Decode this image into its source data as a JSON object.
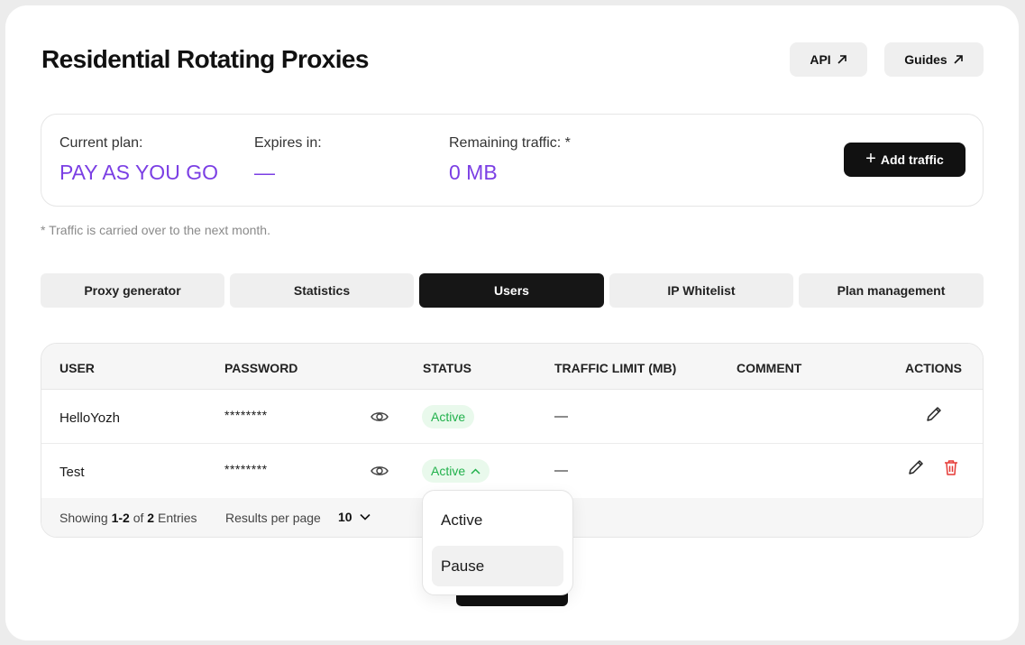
{
  "header": {
    "title": "Residential Rotating Proxies",
    "api_label": "API",
    "guides_label": "Guides"
  },
  "plan": {
    "current_plan_label": "Current plan:",
    "current_plan_value": "PAY AS YOU GO",
    "expires_label": "Expires in:",
    "expires_value": "—",
    "traffic_label": "Remaining traffic: *",
    "traffic_value": "0 MB",
    "add_traffic_label": "Add traffic"
  },
  "note": "* Traffic is carried over to the next month.",
  "tabs": [
    {
      "label": "Proxy generator",
      "active": false
    },
    {
      "label": "Statistics",
      "active": false
    },
    {
      "label": "Users",
      "active": true
    },
    {
      "label": "IP Whitelist",
      "active": false
    },
    {
      "label": "Plan management",
      "active": false
    }
  ],
  "table": {
    "columns": [
      "USER",
      "PASSWORD",
      "STATUS",
      "TRAFFIC LIMIT (MB)",
      "COMMENT",
      "ACTIONS"
    ],
    "rows": [
      {
        "user": "HelloYozh",
        "password": "********",
        "status": "Active",
        "traffic_limit": "—",
        "comment": ""
      },
      {
        "user": "Test",
        "password": "********",
        "status": "Active",
        "traffic_limit": "—",
        "comment": ""
      }
    ],
    "footer": {
      "showing_prefix": "Showing",
      "showing_range": "1-2",
      "showing_of": "of",
      "showing_total": "2",
      "showing_suffix": "Entries",
      "rpp_label": "Results per page",
      "rpp_value": "10"
    }
  },
  "status_dropdown": {
    "options": [
      "Active",
      "Pause"
    ],
    "highlighted": "Pause"
  },
  "colors": {
    "accent": "#7b3fe4",
    "active_green": "#22b14c",
    "delete_red": "#e53935",
    "dark": "#161616"
  }
}
